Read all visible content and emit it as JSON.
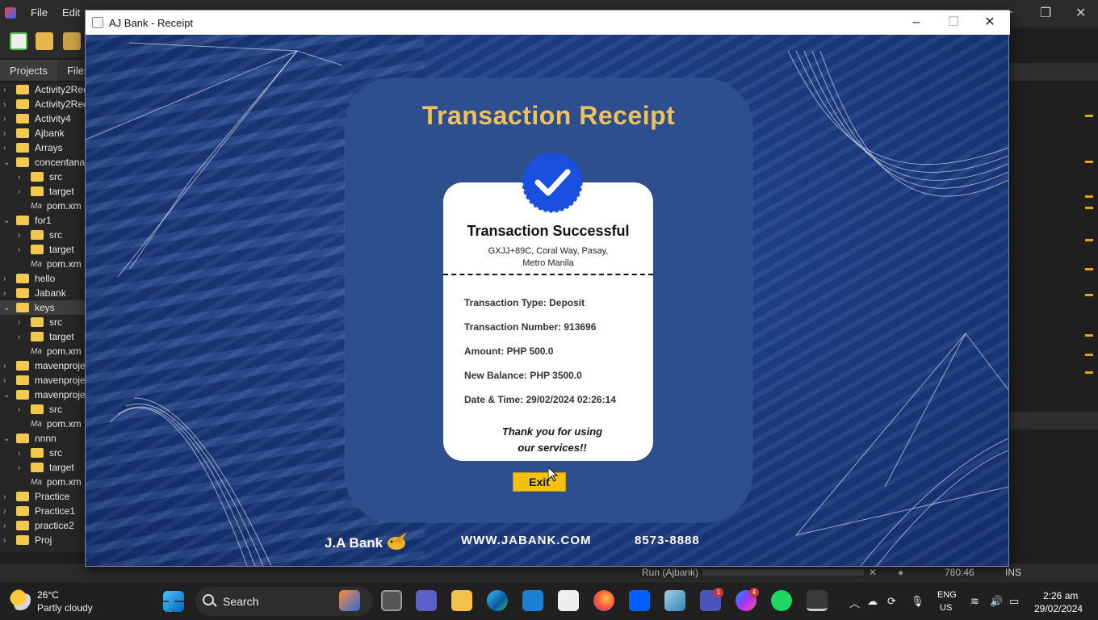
{
  "ide": {
    "menu": [
      "File",
      "Edit"
    ],
    "tabs": [
      "Projects",
      "Files"
    ],
    "tree": [
      {
        "label": "Activity2Rec",
        "type": "folder",
        "expanded": false,
        "depth": 0
      },
      {
        "label": "Activity2Rec",
        "type": "folder",
        "expanded": false,
        "depth": 0
      },
      {
        "label": "Activity4",
        "type": "folder",
        "expanded": false,
        "depth": 0
      },
      {
        "label": "Ajbank",
        "type": "folder",
        "expanded": false,
        "depth": 0
      },
      {
        "label": "Arrays",
        "type": "folder",
        "expanded": false,
        "depth": 0
      },
      {
        "label": "concentana",
        "type": "folder",
        "expanded": true,
        "depth": 0
      },
      {
        "label": "src",
        "type": "folder",
        "expanded": false,
        "depth": 1
      },
      {
        "label": "target",
        "type": "folder",
        "expanded": false,
        "depth": 1
      },
      {
        "label": "pom.xm",
        "type": "maven",
        "depth": 1
      },
      {
        "label": "for1",
        "type": "folder",
        "expanded": true,
        "depth": 0
      },
      {
        "label": "src",
        "type": "folder",
        "expanded": false,
        "depth": 1
      },
      {
        "label": "target",
        "type": "folder",
        "expanded": false,
        "depth": 1
      },
      {
        "label": "pom.xm",
        "type": "maven",
        "depth": 1
      },
      {
        "label": "hello",
        "type": "folder",
        "expanded": false,
        "depth": 0
      },
      {
        "label": "Jabank",
        "type": "folder",
        "expanded": false,
        "depth": 0
      },
      {
        "label": "keys",
        "type": "folder",
        "expanded": true,
        "depth": 0,
        "selected": true
      },
      {
        "label": "src",
        "type": "folder",
        "expanded": false,
        "depth": 1
      },
      {
        "label": "target",
        "type": "folder",
        "expanded": false,
        "depth": 1
      },
      {
        "label": "pom.xm",
        "type": "maven",
        "depth": 1
      },
      {
        "label": "mavenproje",
        "type": "folder",
        "expanded": false,
        "depth": 0
      },
      {
        "label": "mavenproje",
        "type": "folder",
        "expanded": false,
        "depth": 0
      },
      {
        "label": "mavenproje",
        "type": "folder",
        "expanded": true,
        "depth": 0
      },
      {
        "label": "src",
        "type": "folder",
        "expanded": false,
        "depth": 1
      },
      {
        "label": "pom.xm",
        "type": "maven",
        "depth": 1
      },
      {
        "label": "nnnn",
        "type": "folder",
        "expanded": true,
        "depth": 0
      },
      {
        "label": "src",
        "type": "folder",
        "expanded": false,
        "depth": 1
      },
      {
        "label": "target",
        "type": "folder",
        "expanded": false,
        "depth": 1
      },
      {
        "label": "pom.xm",
        "type": "maven",
        "depth": 1
      },
      {
        "label": "Practice",
        "type": "folder",
        "expanded": false,
        "depth": 0
      },
      {
        "label": "Practice1",
        "type": "folder",
        "expanded": false,
        "depth": 0
      },
      {
        "label": "practice2",
        "type": "folder",
        "expanded": false,
        "depth": 0
      },
      {
        "label": "Proj",
        "type": "folder",
        "expanded": false,
        "depth": 0
      }
    ],
    "status": {
      "run_label": "Run (Ajbank)",
      "position": "780:46",
      "mode": "INS"
    }
  },
  "dialog": {
    "title": "AJ Bank - Receipt",
    "receipt_title": "Transaction Receipt",
    "success_text": "Transaction Successful",
    "address_line1": "GXJJ+89C, Coral Way, Pasay,",
    "address_line2": "Metro Manila",
    "fields": [
      "Transaction Type: Deposit",
      "Transaction Number: 913696",
      "Amount: PHP 500.0",
      "New Balance: PHP 3500.0",
      "Date & Time: 29/02/2024 02:26:14"
    ],
    "thanks_line1": "Thank you for using",
    "thanks_line2": "our services!!",
    "exit_label": "Exit",
    "footer": {
      "brand": "J.A Bank",
      "website": "WWW.JABANK.COM",
      "phone": "8573-8888"
    },
    "colors": {
      "title_gold": "#f0c05a",
      "panel_blue": "#2d4f8e",
      "check_blue": "#1a4fe0",
      "exit_yellow": "#f3c20f"
    }
  },
  "taskbar": {
    "weather_temp": "26°C",
    "weather_desc": "Partly cloudy",
    "search_label": "Search",
    "teams_badge": "1",
    "messenger_badge": "4",
    "lang": "ENG",
    "region": "US",
    "time": "2:26 am",
    "date": "29/02/2024"
  }
}
